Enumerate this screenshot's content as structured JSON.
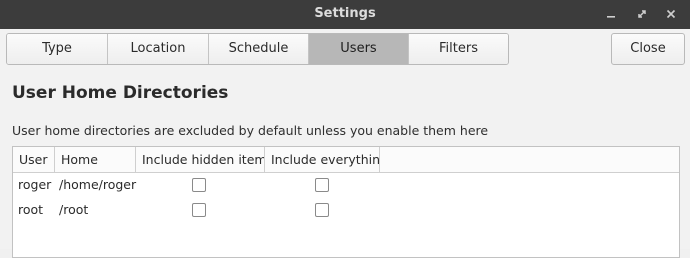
{
  "window": {
    "title": "Settings",
    "controls": {
      "minimize_icon": "minimize-icon",
      "maximize_icon": "maximize-icon",
      "close_icon": "close-icon"
    }
  },
  "tabs": [
    {
      "label": "Type",
      "active": false
    },
    {
      "label": "Location",
      "active": false
    },
    {
      "label": "Schedule",
      "active": false
    },
    {
      "label": "Users",
      "active": true
    },
    {
      "label": "Filters",
      "active": false
    }
  ],
  "close_button": {
    "label": "Close"
  },
  "section": {
    "heading": "User Home Directories",
    "description": "User home directories are excluded by default unless you enable them here"
  },
  "table": {
    "columns": [
      "User",
      "Home",
      "Include hidden items",
      "Include everything"
    ],
    "rows": [
      {
        "user": "roger",
        "home": "/home/roger",
        "include_hidden": false,
        "include_everything": false
      },
      {
        "user": "root",
        "home": "/root",
        "include_hidden": false,
        "include_everything": false
      }
    ]
  },
  "colors": {
    "titlebar": "#3c3c3c",
    "active_tab": "#b7b7b7",
    "background": "#f2f2f2"
  }
}
